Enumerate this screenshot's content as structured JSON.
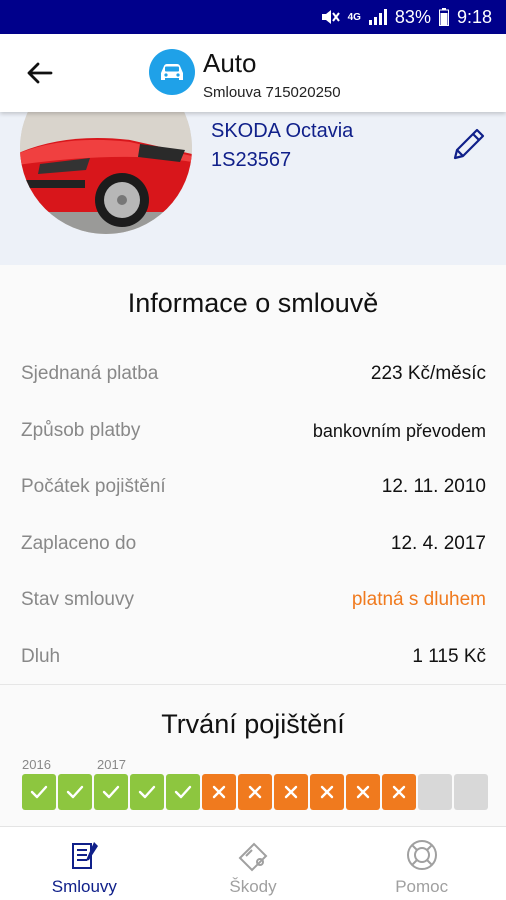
{
  "status_bar": {
    "network": "4G",
    "battery": "83%",
    "time": "9:18"
  },
  "header": {
    "title": "Auto",
    "subtitle": "Smlouva 715020250",
    "avatar_icon": "car-icon"
  },
  "vehicle": {
    "name": "SKODA Octavia",
    "plate": "1S23567"
  },
  "info": {
    "title": "Informace o smlouvě",
    "rows": [
      {
        "label": "Sjednaná platba",
        "value": "223 Kč/měsíc"
      },
      {
        "label": "Způsob platby",
        "value": "bankovním převodem"
      },
      {
        "label": "Počátek pojištění",
        "value": "12. 11. 2010"
      },
      {
        "label": "Zaplaceno do",
        "value": "12. 4. 2017"
      },
      {
        "label": "Stav smlouvy",
        "value": "platná s dluhem"
      },
      {
        "label": "Dluh",
        "value": "1 115 Kč"
      }
    ]
  },
  "timeline": {
    "title": "Trvání pojištění",
    "years": [
      "2016",
      "2017"
    ],
    "months": [
      "paid",
      "paid",
      "paid",
      "paid",
      "paid",
      "debt",
      "debt",
      "debt",
      "debt",
      "debt",
      "debt",
      "future",
      "future"
    ]
  },
  "colors": {
    "status_bar": "#00008b",
    "accent": "#10208a",
    "paid": "#8dc63f",
    "debt": "#f07a1e",
    "future": "#d8d8d8",
    "avatar": "#1fa1e8"
  },
  "nav": {
    "items": [
      {
        "label": "Smlouvy",
        "icon": "contracts-icon",
        "active": true
      },
      {
        "label": "Škody",
        "icon": "damages-icon",
        "active": false
      },
      {
        "label": "Pomoc",
        "icon": "help-icon",
        "active": false
      }
    ]
  }
}
